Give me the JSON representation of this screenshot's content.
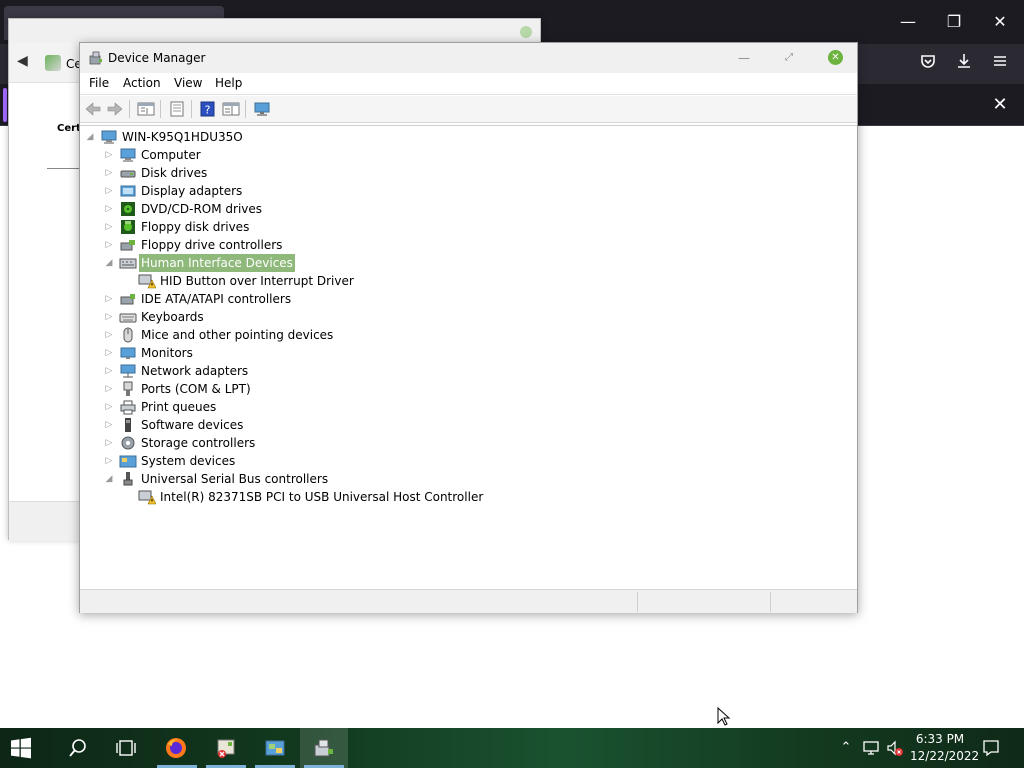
{
  "firefox": {
    "window_controls": {
      "minimize": "—",
      "restore": "❐",
      "close": "✕"
    },
    "toolbar_icons": [
      "pocket-icon",
      "download-icon",
      "menu-icon"
    ],
    "notification_close": "✕"
  },
  "cert_window": {
    "nav_text": "Ce",
    "side_label": "Certi"
  },
  "device_manager": {
    "title": "Device Manager",
    "menu": [
      "File",
      "Action",
      "View",
      "Help"
    ],
    "toolbar_icons": [
      "back-icon",
      "forward-icon",
      "show-hide-console-tree-icon",
      "properties-icon",
      "help-icon",
      "action-pane-icon",
      "scan-hardware-icon"
    ],
    "tree": {
      "root": "WIN-K95Q1HDU35O",
      "items": [
        {
          "label": "Computer",
          "expanded": false,
          "icon": "computer-icon"
        },
        {
          "label": "Disk drives",
          "expanded": false,
          "icon": "disk-drive-icon"
        },
        {
          "label": "Display adapters",
          "expanded": false,
          "icon": "display-adapter-icon"
        },
        {
          "label": "DVD/CD-ROM drives",
          "expanded": false,
          "icon": "dvd-drive-icon"
        },
        {
          "label": "Floppy disk drives",
          "expanded": false,
          "icon": "floppy-disk-icon"
        },
        {
          "label": "Floppy drive controllers",
          "expanded": false,
          "icon": "floppy-controller-icon"
        },
        {
          "label": "Human Interface Devices",
          "expanded": true,
          "selected": true,
          "icon": "hid-icon",
          "children": [
            {
              "label": "HID Button over Interrupt Driver",
              "icon": "warning-device-icon"
            }
          ]
        },
        {
          "label": "IDE ATA/ATAPI controllers",
          "expanded": false,
          "icon": "ide-controller-icon"
        },
        {
          "label": "Keyboards",
          "expanded": false,
          "icon": "keyboard-icon"
        },
        {
          "label": "Mice and other pointing devices",
          "expanded": false,
          "icon": "mouse-icon"
        },
        {
          "label": "Monitors",
          "expanded": false,
          "icon": "monitor-icon"
        },
        {
          "label": "Network adapters",
          "expanded": false,
          "icon": "network-adapter-icon"
        },
        {
          "label": "Ports (COM & LPT)",
          "expanded": false,
          "icon": "port-icon"
        },
        {
          "label": "Print queues",
          "expanded": false,
          "icon": "printer-icon"
        },
        {
          "label": "Software devices",
          "expanded": false,
          "icon": "software-device-icon"
        },
        {
          "label": "Storage controllers",
          "expanded": false,
          "icon": "storage-controller-icon"
        },
        {
          "label": "System devices",
          "expanded": false,
          "icon": "system-device-icon"
        },
        {
          "label": "Universal Serial Bus controllers",
          "expanded": true,
          "icon": "usb-icon",
          "children": [
            {
              "label": "Intel(R) 82371SB PCI to USB Universal Host Controller",
              "icon": "warning-device-icon"
            }
          ]
        }
      ]
    },
    "selection_color": "#8fb97a",
    "warning_color": "#f2c12e"
  },
  "taskbar": {
    "apps": [
      "start-icon",
      "search-icon",
      "task-view-icon",
      "firefox-icon",
      "certificate-manager-icon",
      "control-panel-icon",
      "device-manager-icon"
    ],
    "tray": [
      "show-hidden-icons-icon",
      "network-icon",
      "volume-muted-icon"
    ],
    "time": "6:33 PM",
    "date": "12/22/2022",
    "notification_icon": "action-center-icon"
  }
}
